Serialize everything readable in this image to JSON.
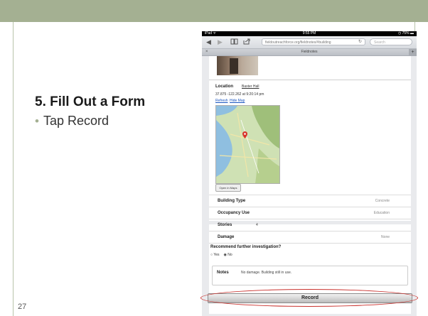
{
  "slide": {
    "title": "5. Fill Out a Form",
    "bullet": "Tap Record",
    "page_number": "27"
  },
  "ipad": {
    "status": {
      "carrier": "iPad ᯤ",
      "time": "9:55 PM",
      "battery": "◷ 75% ▬"
    },
    "browser": {
      "url": "fieldoutreachforce.org/fieldnotes/#building",
      "search_placeholder": "Search",
      "tab_title": "Fieldnotes",
      "tab_close": "×",
      "tab_add": "+",
      "icons": [
        "back-icon",
        "forward-icon",
        "bookmarks-icon",
        "share-icon",
        "reload-icon"
      ]
    },
    "location": {
      "label": "Location",
      "value": "Baxter Hall",
      "coords": "37.875 -122.262 at 9:20:14 pm",
      "refresh_link": "Refresh",
      "hide_map_link": "Hide Map",
      "open_in_maps": "Open in Maps"
    },
    "form": {
      "rows": [
        {
          "label": "Building Type",
          "value": "Concrete"
        },
        {
          "label": "Occupancy Use",
          "value": "Education"
        },
        {
          "label": "Stories",
          "value": "4"
        },
        {
          "label": "Damage",
          "value": "None"
        }
      ],
      "question": "Recommend further investigation?",
      "options": [
        "Yes",
        "No"
      ],
      "selected_option": "No",
      "notes_label": "Notes",
      "notes_value": "No damage. Building still in use."
    },
    "record_button": "Record"
  },
  "colors": {
    "header_band": "#a4b092",
    "highlight_ring": "#c9302c",
    "link": "#1a55c0"
  }
}
